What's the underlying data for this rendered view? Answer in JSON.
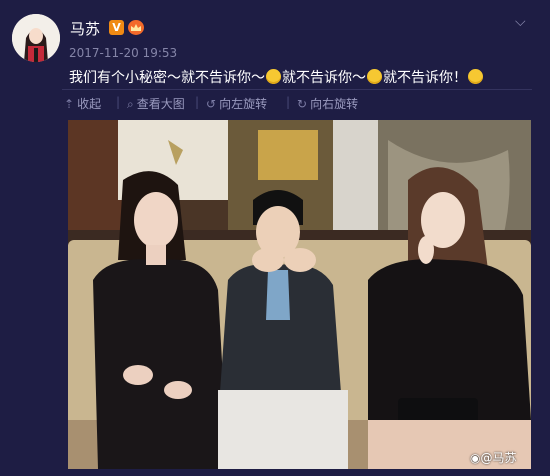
{
  "post": {
    "username": "马苏",
    "verified_badge": "V",
    "timestamp": "2017-11-20 19:53",
    "text_parts": [
      "我们有个小秘密～就不告诉你～",
      "就不告诉你～",
      "就不告诉你！"
    ],
    "watermark": "@马苏"
  },
  "toolbar": {
    "collect": "收起",
    "view_large": "查看大图",
    "rotate_left": "向左旋转",
    "rotate_right": "向右旋转"
  },
  "icons": {
    "collect": "collapse-arrow-icon",
    "view_large": "magnify-icon",
    "rotate_left": "rotate-left-icon",
    "rotate_right": "rotate-right-icon",
    "menu": "chevron-down-icon",
    "watermark": "weibo-logo-icon"
  },
  "colors": {
    "background": "#1e1d44",
    "badge_orange": "#f08a14",
    "text": "#ffffff",
    "muted": "#8585a8"
  }
}
